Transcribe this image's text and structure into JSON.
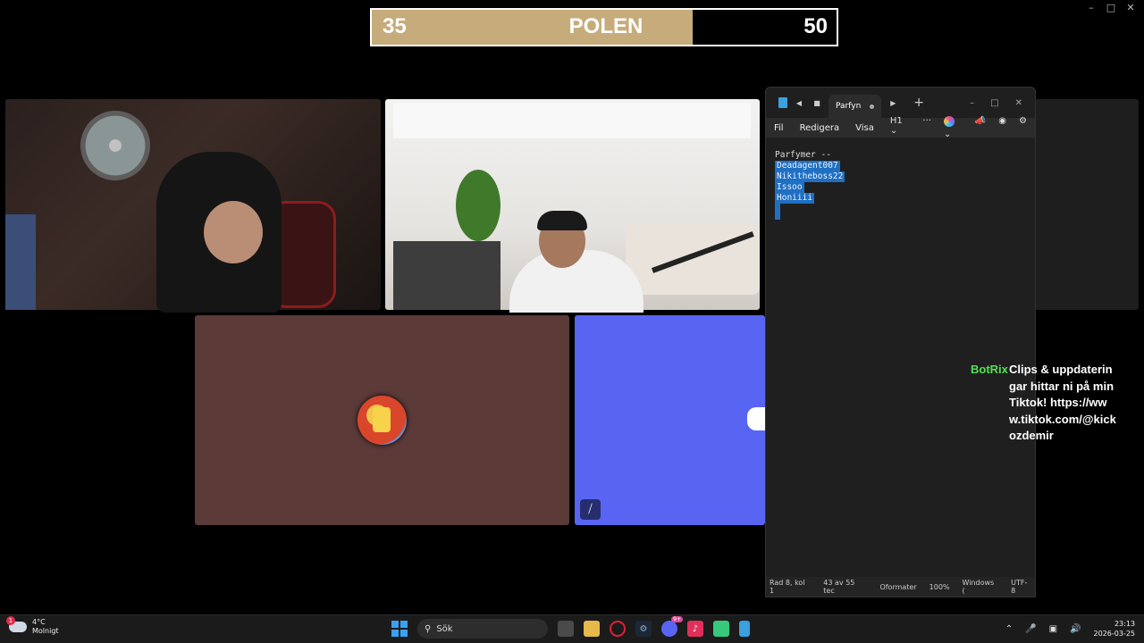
{
  "scoreboard": {
    "left_score": "35",
    "title": "POLEN",
    "right_score": "50",
    "fill_fraction": 0.69
  },
  "notepad": {
    "tab_title": "Parfyn",
    "menu": [
      "Fil",
      "Redigera",
      "Visa"
    ],
    "heading_dropdown": "H1",
    "more": "···",
    "lines": [
      "Parfymer --",
      "Deadagent007",
      "Nikitheboss22",
      "Issoo",
      "Honiiii"
    ],
    "status": [
      "Rad 8, kol 1",
      "43 av 55 tec",
      "Oformater",
      "100%",
      "Windows (",
      "UTF-8"
    ]
  },
  "chat": {
    "user": "BotRix",
    "message": "Clips & uppdateringar hittar ni på min Tiktok! https://www.tiktok.com/@kickozdemir"
  },
  "taskbar": {
    "weather_temp": "4°C",
    "weather_desc": "Molnigt",
    "weather_badge": "1",
    "search_label": "Sök",
    "discord_badge": "9+",
    "time": "23:13",
    "date": "2026-03-25"
  },
  "colors": {
    "score_gold": "#c6ab7b",
    "avatar_tile": "#5b3a38",
    "discord_blurple": "#5865f2",
    "selection": "#1f6fc2",
    "botrix_green": "#52e052"
  },
  "icons": [
    "minimize-icon",
    "maximize-icon",
    "close-icon",
    "mic-muted-icon",
    "discord-icon",
    "weather-cloud-icon",
    "start-icon",
    "search-icon",
    "task-view-icon",
    "file-explorer-icon",
    "opera-icon",
    "steam-icon",
    "discord-icon",
    "tiktok-icon",
    "android-icon",
    "notepad-icon",
    "chevron-up-icon",
    "microphone-icon",
    "network-icon",
    "volume-icon",
    "settings-icon",
    "copilot-icon"
  ]
}
